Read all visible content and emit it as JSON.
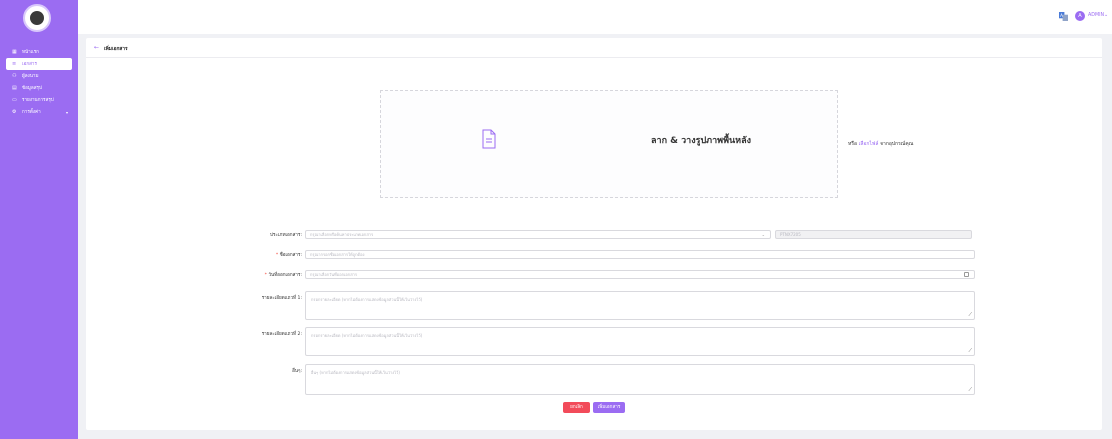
{
  "sidebar": {
    "items": [
      {
        "icon": "grid-icon",
        "glyph": "▦",
        "label": "หน้าแรก",
        "active": false,
        "caret": false
      },
      {
        "icon": "document-icon",
        "glyph": "≡",
        "label": "เอกสาร",
        "active": true,
        "caret": false
      },
      {
        "icon": "users-icon",
        "glyph": "⚇",
        "label": "ผู้ลงนาม",
        "active": false,
        "caret": false
      },
      {
        "icon": "table-icon",
        "glyph": "▤",
        "label": "ข้อมูลสรุป",
        "active": false,
        "caret": false
      },
      {
        "icon": "report-icon",
        "glyph": "▭",
        "label": "รายงานการสรุป",
        "active": false,
        "caret": false
      },
      {
        "icon": "gear-icon",
        "glyph": "⚙",
        "label": "การตั้งค่า",
        "active": false,
        "caret": true
      }
    ]
  },
  "topbar": {
    "user_initial": "A",
    "user_label": "ADMIN"
  },
  "page": {
    "title": "เพิ่มเอกสาร"
  },
  "upload": {
    "title": "ลาก & วางรูปภาพพื้นหลัง",
    "or_text": "หรือ",
    "link_text": "เลือกไฟล์",
    "suffix_text": "จากอุปกรณ์คุณ"
  },
  "form": {
    "doc_type_label": "ประเภทเอกสาร:",
    "doc_type_placeholder": "กรุณาเลือกหรือค้นหาประเภทเอกสาร",
    "doc_code_value": "PTNX7205",
    "doc_name_label": "ชื่อเอกสาร:",
    "doc_name_placeholder": "กรุณากรอกชื่อเอกสารให้ถูกต้อง",
    "date_label": "วันที่ออกเอกสาร:",
    "date_placeholder": "กรุณาเลือกวันที่ออกเอกสาร",
    "detail1_label": "รายละเอียดแถวที่ 1:",
    "detail1_placeholder": "กรอกรายละเอียด (หากไม่ต้องการแสดงข้อมูลส่วนนี้ให้เว้นว่างไว้)",
    "detail2_label": "รายละเอียดแถวที่ 2:",
    "detail2_placeholder": "กรอกรายละเอียด (หากไม่ต้องการแสดงข้อมูลส่วนนี้ให้เว้นว่างไว้)",
    "remark_label": "อื่นๆ:",
    "remark_placeholder": "อื่นๆ (หากไม่ต้องการแสดงข้อมูลส่วนนี้ให้เว้นว่างไว้)"
  },
  "actions": {
    "cancel_label": "ยกเลิก",
    "submit_label": "เพิ่มเอกสาร"
  },
  "colors": {
    "accent": "#9b6cf2",
    "danger": "#f24b5a"
  }
}
